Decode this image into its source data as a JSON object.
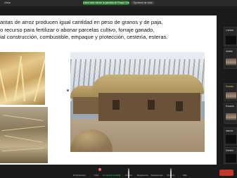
{
  "topbar": {
    "view_label": "Vista",
    "recording_label": "Usted está viendo la pantalla de Roque Gonzalez",
    "end_label": "Opciones de vista"
  },
  "slide": {
    "lines": [
      "antas de arroz producen igual cantidad en peso de granos y de paja.",
      "o recurso para fertilizar o abonar parcelas cultivo, forraje ganado,",
      "ial construcción, combustible, empaque y protección, cestería, esteras."
    ]
  },
  "participants": [
    {
      "name": "Luciano",
      "color": "#dddddd"
    },
    {
      "name": "Anabel",
      "color": "#dddddd"
    },
    {
      "name": "Ernesto",
      "color": "#e6c14a"
    },
    {
      "name": "Eduardo",
      "color": "#dddddd"
    },
    {
      "name": "antonio",
      "color": "#dddddd"
    },
    {
      "name": "Daniela",
      "color": "#dddddd"
    }
  ],
  "toolbar": {
    "items": [
      {
        "label": "Participantes",
        "icon": "people-icon"
      },
      {
        "label": "Chat",
        "icon": "chat-icon"
      },
      {
        "label": "Compartir pantalla",
        "icon": "share-screen-icon"
      },
      {
        "label": "Grabar",
        "icon": "record-icon"
      },
      {
        "label": "Reacciones",
        "icon": "reactions-icon"
      },
      {
        "label": "Aplicaciones",
        "icon": "apps-icon"
      },
      {
        "label": "Pizarras",
        "icon": "whiteboard-icon"
      },
      {
        "label": "Más",
        "icon": "more-icon"
      }
    ],
    "chat_badge": "1"
  }
}
